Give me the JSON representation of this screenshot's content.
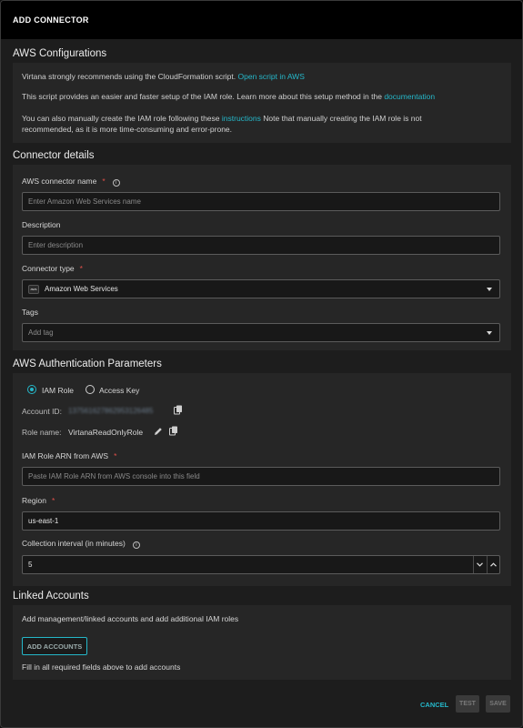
{
  "modal": {
    "title": "ADD CONNECTOR"
  },
  "aws_config": {
    "title": "AWS Configurations",
    "line1_text": "Virtana strongly recommends using the CloudFormation script.",
    "line1_link": "Open script in AWS",
    "line2_text": "This script provides an easier and faster setup of the IAM role. Learn more about this setup method in the",
    "line2_link": "documentation",
    "line3_text_a": "You can also manually create the IAM role following these",
    "line3_link": "instructions",
    "line3_text_b": "Note that manually creating the IAM role is not",
    "line3_text_c": "recommended, as it is more time-consuming and error-prone."
  },
  "connector_details": {
    "title": "Connector details",
    "name_label": "AWS connector name",
    "name_placeholder": "Enter Amazon Web Services name",
    "description_label": "Description",
    "description_placeholder": "Enter description",
    "type_label": "Connector type",
    "type_value": "Amazon Web Services",
    "type_icon_text": "aws",
    "tags_label": "Tags",
    "tags_placeholder": "Add tag"
  },
  "auth": {
    "title": "AWS Authentication Parameters",
    "radio_iam": "IAM Role",
    "radio_access_key": "Access Key",
    "account_id_label": "Account ID:",
    "account_id_value": "137561627862953126485",
    "role_name_label": "Role name:",
    "role_name_value": "VirtanaReadOnlyRole",
    "arn_label": "IAM Role ARN from AWS",
    "arn_placeholder": "Paste IAM Role ARN from AWS console into this field",
    "region_label": "Region",
    "region_value": "us-east-1",
    "interval_label": "Collection interval (in minutes)",
    "interval_value": "5"
  },
  "linked": {
    "title": "Linked Accounts",
    "description": "Add management/linked accounts and add additional IAM roles",
    "add_button": "ADD ACCOUNTS",
    "hint": "Fill in all required fields above to add accounts"
  },
  "footer": {
    "cancel": "CANCEL",
    "test": "TEST",
    "save": "SAVE"
  },
  "colors": {
    "accent": "#25b7c9",
    "required": "#e0504a",
    "background": "#1d1d1d",
    "panel": "#262626"
  }
}
